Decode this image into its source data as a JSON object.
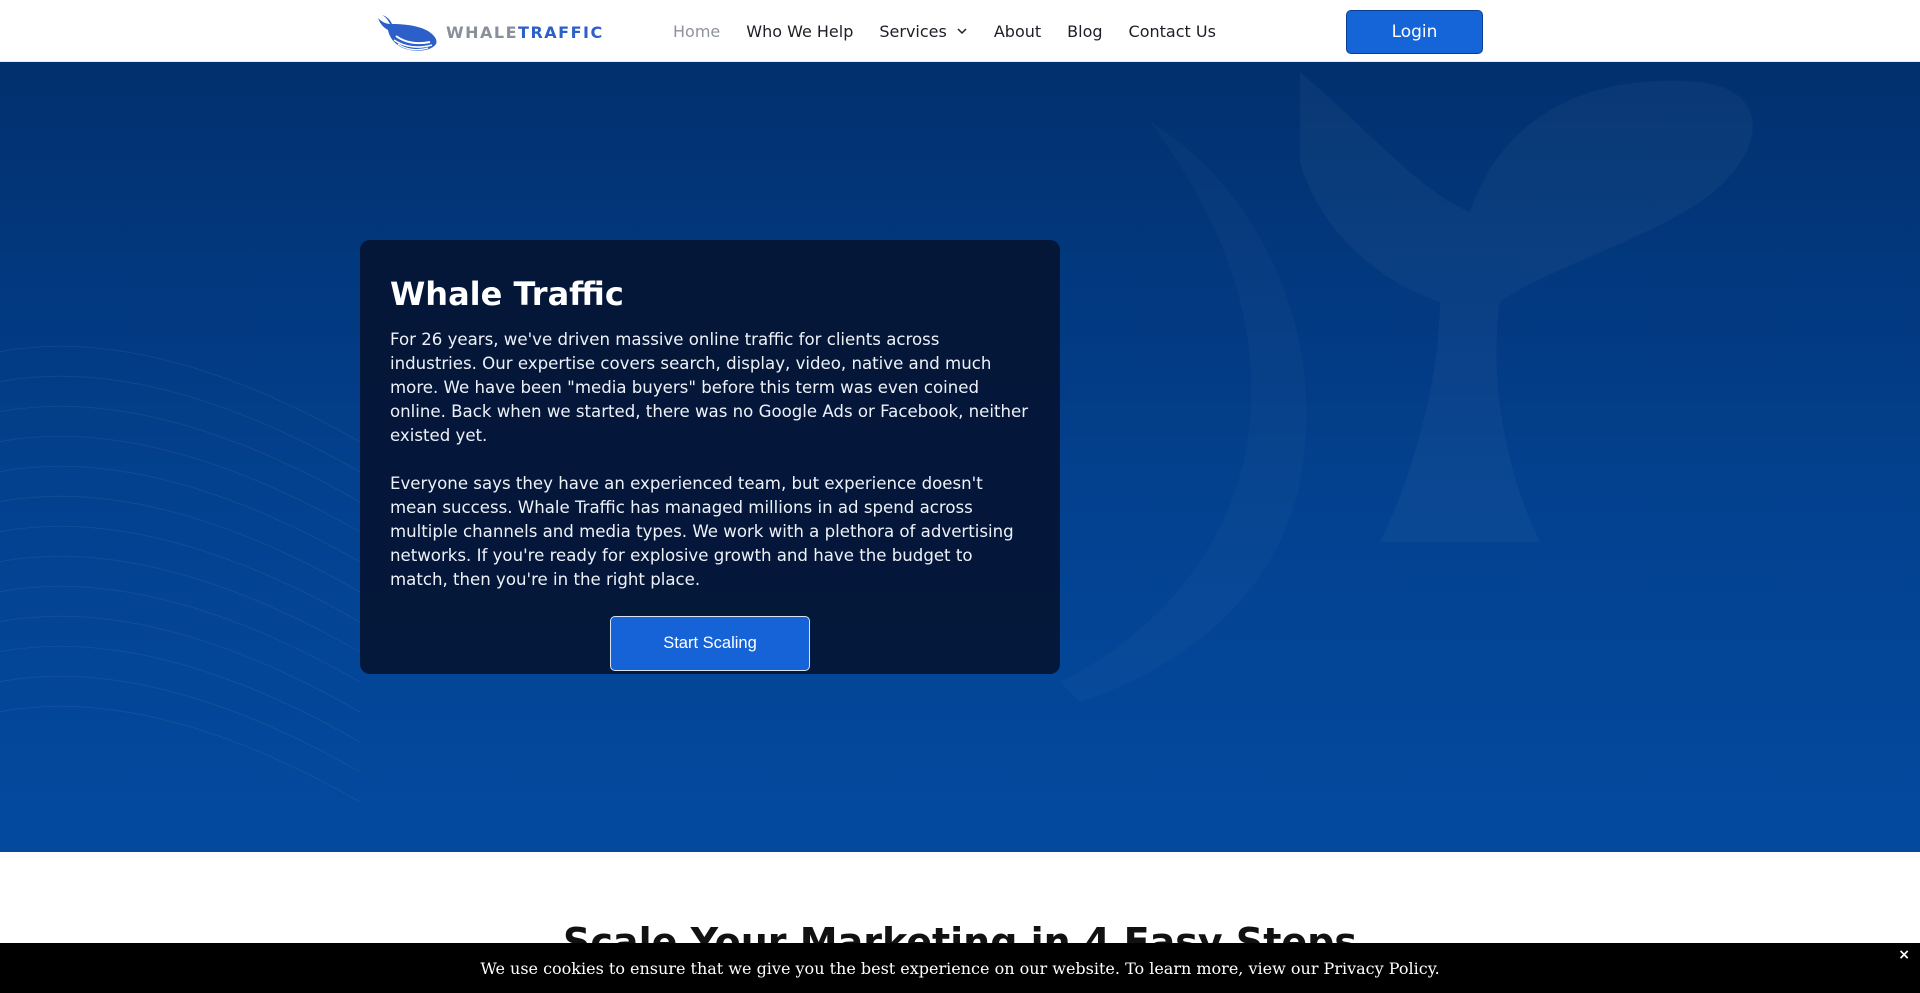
{
  "brand": {
    "logo_word1": "WHALE",
    "logo_word2": "TRAFFIC",
    "primary_color": "#1565d8",
    "accent_color": "#2c5fc9"
  },
  "nav": {
    "items": [
      {
        "label": "Home",
        "active": true
      },
      {
        "label": "Who We Help"
      },
      {
        "label": "Services",
        "has_dropdown": true
      },
      {
        "label": "About"
      },
      {
        "label": "Blog"
      },
      {
        "label": "Contact Us"
      }
    ],
    "login_label": "Login"
  },
  "hero": {
    "title": "Whale Traffic",
    "paragraphs": [
      "For 26 years, we've driven massive online traffic for clients across industries. Our expertise covers search, display, video, native and much more. We have been \"media buyers\" before this term was even coined online. Back when we started, there was no Google Ads or Facebook, neither existed yet.",
      "Everyone says they have an experienced team, but experience doesn't mean success. Whale Traffic has managed millions in ad spend across multiple channels and media types. We work with a plethora of advertising networks. If you're ready for explosive growth and have the budget to match, then you're in the right place."
    ],
    "cta_label": "Start Scaling"
  },
  "section": {
    "title": "Scale Your Marketing in 4 Easy Steps"
  },
  "cookie": {
    "text": "We use cookies to ensure that we give you the best experience on our website. To learn more, view our Privacy Policy.",
    "close_symbol": "×"
  }
}
